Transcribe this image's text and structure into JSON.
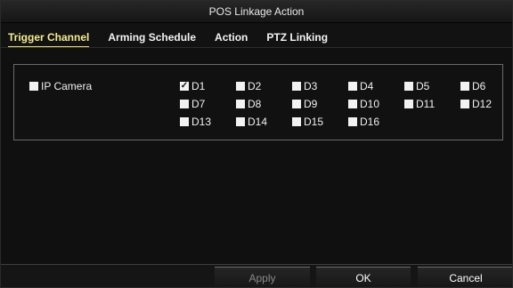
{
  "window": {
    "title": "POS Linkage Action"
  },
  "tabs": [
    {
      "label": "Trigger Channel",
      "active": true
    },
    {
      "label": "Arming Schedule",
      "active": false
    },
    {
      "label": "Action",
      "active": false
    },
    {
      "label": "PTZ Linking",
      "active": false
    }
  ],
  "trigger_channel": {
    "ip_camera": {
      "label": "IP Camera",
      "checked": false
    },
    "channels": [
      {
        "label": "D1",
        "checked": true
      },
      {
        "label": "D2",
        "checked": false
      },
      {
        "label": "D3",
        "checked": false
      },
      {
        "label": "D4",
        "checked": false
      },
      {
        "label": "D5",
        "checked": false
      },
      {
        "label": "D6",
        "checked": false
      },
      {
        "label": "D7",
        "checked": false
      },
      {
        "label": "D8",
        "checked": false
      },
      {
        "label": "D9",
        "checked": false
      },
      {
        "label": "D10",
        "checked": false
      },
      {
        "label": "D11",
        "checked": false
      },
      {
        "label": "D12",
        "checked": false
      },
      {
        "label": "D13",
        "checked": false
      },
      {
        "label": "D14",
        "checked": false
      },
      {
        "label": "D15",
        "checked": false
      },
      {
        "label": "D16",
        "checked": false
      }
    ]
  },
  "buttons": {
    "apply": "Apply",
    "ok": "OK",
    "cancel": "Cancel"
  },
  "colors": {
    "active_tab": "#f4ed8f",
    "background": "#121212",
    "panel_border": "#6a6a6a",
    "disabled_button_text": "#8a8a8a"
  }
}
